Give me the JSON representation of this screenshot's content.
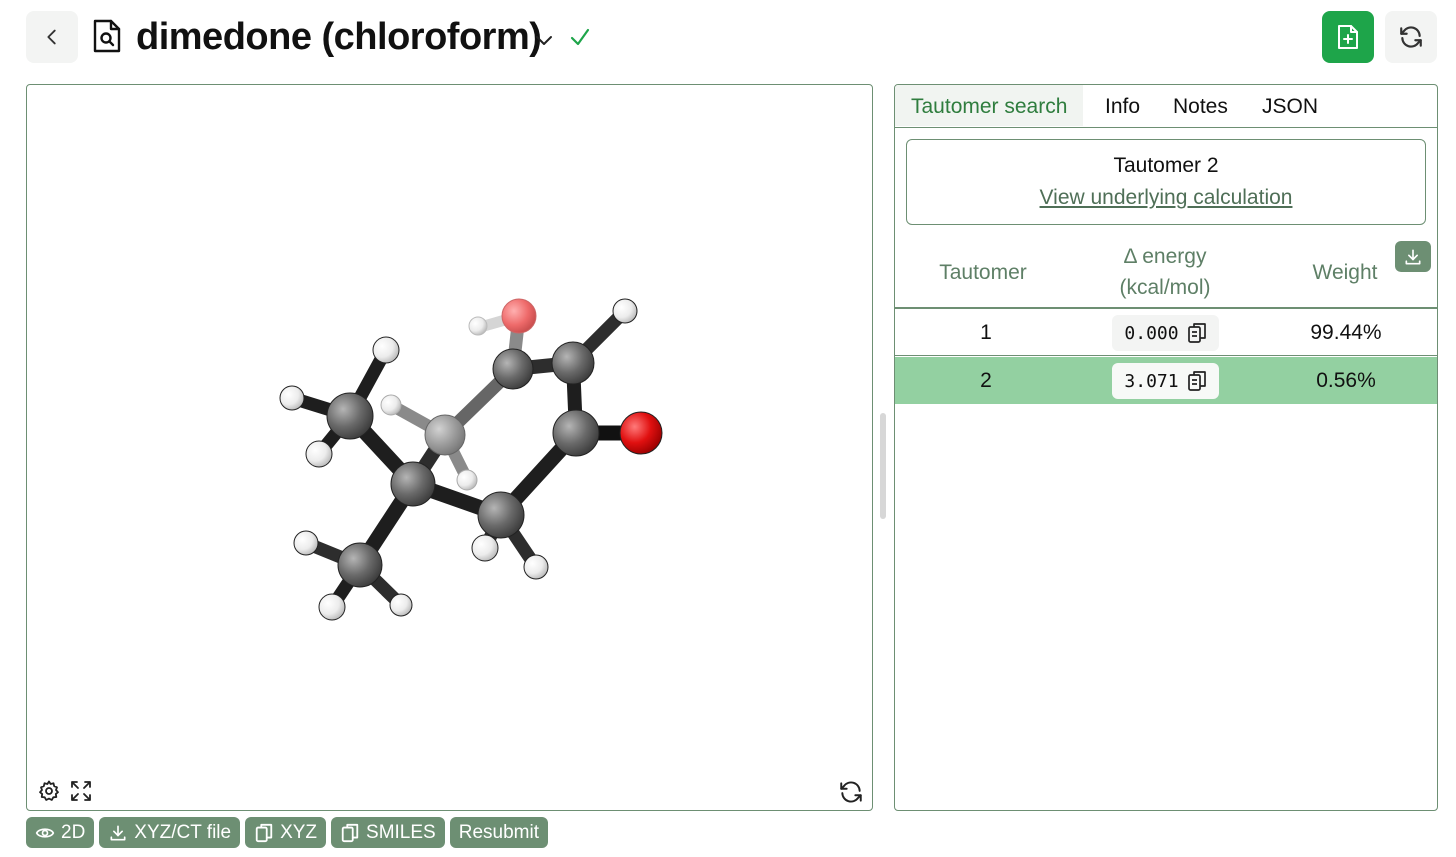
{
  "header": {
    "title": "dimedone (chloroform)",
    "status": "complete",
    "icons": {
      "back": "chevron-left-icon",
      "doc": "file-search-icon",
      "new": "file-plus-icon",
      "refresh": "refresh-icon"
    }
  },
  "tabs": [
    {
      "label": "Tautomer search",
      "active": true
    },
    {
      "label": "Info",
      "active": false
    },
    {
      "label": "Notes",
      "active": false
    },
    {
      "label": "JSON",
      "active": false
    }
  ],
  "tautomer_panel": {
    "selected_label": "Tautomer 2",
    "link_label": "View underlying calculation",
    "columns": {
      "tautomer": "Tautomer",
      "energy_line1": "Δ energy",
      "energy_line2": "(kcal/mol)",
      "weight": "Weight"
    },
    "rows": [
      {
        "tautomer": "1",
        "energy": "0.000",
        "weight": "99.44%",
        "selected": false
      },
      {
        "tautomer": "2",
        "energy": "3.071",
        "weight": "0.56%",
        "selected": true
      }
    ]
  },
  "bottom_actions": [
    {
      "label": "2D",
      "icon": "eye-icon"
    },
    {
      "label": "XYZ/CT file",
      "icon": "download-icon"
    },
    {
      "label": "XYZ",
      "icon": "copy-icon"
    },
    {
      "label": "SMILES",
      "icon": "copy-icon"
    },
    {
      "label": "Resubmit",
      "icon": ""
    }
  ],
  "colors": {
    "accent": "#6d8f73",
    "primary_button": "#1ea54a",
    "selected_row": "#93d0a1",
    "active_tab_text": "#2f7d3e",
    "atom_carbon": "#6a6a6a",
    "atom_oxygen": "#e01010",
    "atom_hydrogen": "#f2f2f2"
  }
}
